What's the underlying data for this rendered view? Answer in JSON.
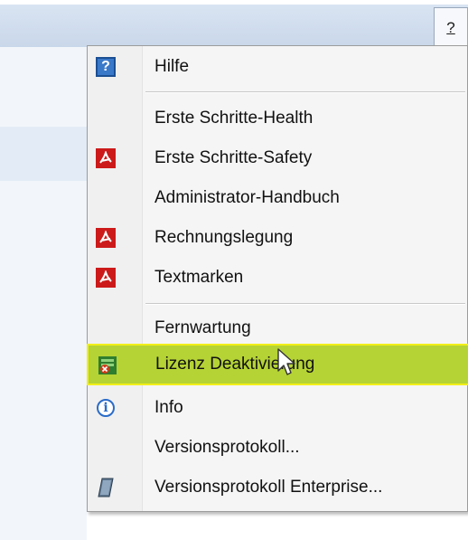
{
  "menubar": {
    "help_label": "?"
  },
  "menu": {
    "items": [
      {
        "label": "Hilfe",
        "icon": "help-book-icon"
      },
      {
        "label": "Erste Schritte-Health",
        "icon": ""
      },
      {
        "label": "Erste Schritte-Safety",
        "icon": "pdf-icon"
      },
      {
        "label": "Administrator-Handbuch",
        "icon": ""
      },
      {
        "label": "Rechnungslegung",
        "icon": "pdf-icon"
      },
      {
        "label": "Textmarken",
        "icon": "pdf-icon"
      },
      {
        "label": "Fernwartung",
        "icon": ""
      },
      {
        "label": "Lizenz Deaktivierung",
        "icon": "license-deactivate-icon"
      },
      {
        "label": "Info",
        "icon": "info-icon"
      },
      {
        "label": "Versionsprotokoll...",
        "icon": ""
      },
      {
        "label": "Versionsprotokoll Enterprise...",
        "icon": "document-icon"
      }
    ]
  },
  "colors": {
    "highlight": "#b5d335",
    "highlight_border": "#f2ef18",
    "pdf_red": "#cc1a1a",
    "menubar": "#c9d7ea"
  }
}
